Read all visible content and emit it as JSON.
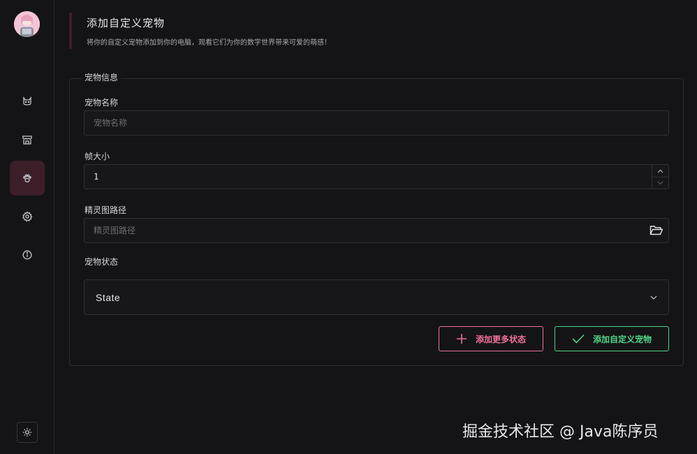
{
  "header": {
    "title": "添加自定义宠物",
    "subtitle": "将你的自定义宠物添加到你的电脑，观看它们为你的数字世界带来可爱的萌感！"
  },
  "sidebar": {
    "items": [
      {
        "icon": "cat-icon",
        "active": false
      },
      {
        "icon": "store-icon",
        "active": false
      },
      {
        "icon": "paw-icon",
        "active": true
      },
      {
        "icon": "gear-icon",
        "active": false
      },
      {
        "icon": "info-icon",
        "active": false
      }
    ],
    "theme_icon": "sun-icon"
  },
  "form": {
    "legend": "宠物信息",
    "pet_name": {
      "label": "宠物名称",
      "placeholder": "宠物名称",
      "value": ""
    },
    "frame_size": {
      "label": "帧大小",
      "value": "1"
    },
    "sprite_path": {
      "label": "精灵图路径",
      "placeholder": "精灵图路径",
      "value": ""
    },
    "pet_state": {
      "label": "宠物状态",
      "value": "State"
    }
  },
  "actions": {
    "add_state": "添加更多状态",
    "add_pet": "添加自定义宠物"
  },
  "colors": {
    "accent_pink": "#f0719b",
    "accent_green": "#4fd486",
    "active_bg": "#3a1f29"
  },
  "watermark": "掘金技术社区 @ Java陈序员"
}
